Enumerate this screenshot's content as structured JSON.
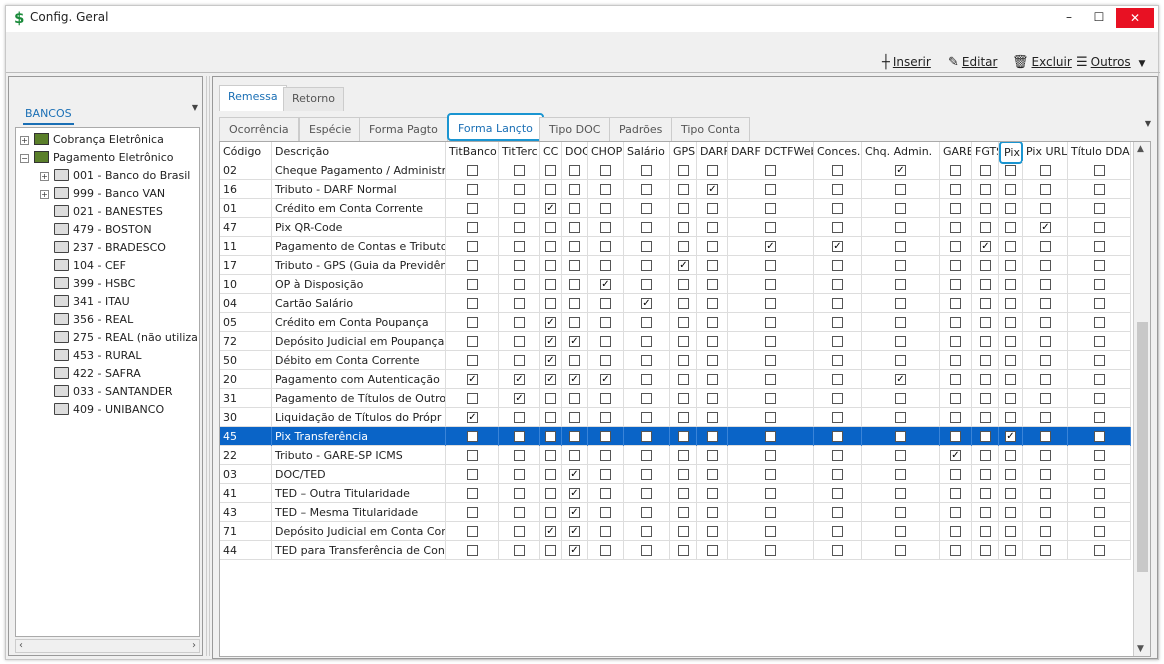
{
  "window": {
    "title": "Config. Geral",
    "minimize": "–",
    "maximize": "☐",
    "close": "✕"
  },
  "toolbar": {
    "inserir": "Inserir",
    "editar": "Editar",
    "excluir": "Excluir",
    "outros": "Outros"
  },
  "left": {
    "tab": "BANCOS",
    "tree": [
      {
        "label": "Cobrança Eletrônica",
        "level": 0,
        "exp": "+",
        "icon": "db"
      },
      {
        "label": "Pagamento Eletrônico",
        "level": 0,
        "exp": "-",
        "icon": "db"
      },
      {
        "label": "001 - Banco do Brasil",
        "level": 1,
        "exp": "+",
        "icon": "bank"
      },
      {
        "label": "999 - Banco VAN",
        "level": 1,
        "exp": "+",
        "icon": "bank"
      },
      {
        "label": "021 - BANESTES",
        "level": 1,
        "exp": "",
        "icon": "bank"
      },
      {
        "label": "479 - BOSTON",
        "level": 1,
        "exp": "",
        "icon": "bank"
      },
      {
        "label": "237 - BRADESCO",
        "level": 1,
        "exp": "",
        "icon": "bank"
      },
      {
        "label": "104 - CEF",
        "level": 1,
        "exp": "",
        "icon": "bank"
      },
      {
        "label": "399 - HSBC",
        "level": 1,
        "exp": "",
        "icon": "bank"
      },
      {
        "label": "341 - ITAU",
        "level": 1,
        "exp": "",
        "icon": "bank"
      },
      {
        "label": "356 - REAL",
        "level": 1,
        "exp": "",
        "icon": "bank"
      },
      {
        "label": "275 - REAL (não utiliza",
        "level": 1,
        "exp": "",
        "icon": "bank"
      },
      {
        "label": "453 - RURAL",
        "level": 1,
        "exp": "",
        "icon": "bank"
      },
      {
        "label": "422 - SAFRA",
        "level": 1,
        "exp": "",
        "icon": "bank"
      },
      {
        "label": "033 - SANTANDER",
        "level": 1,
        "exp": "",
        "icon": "bank"
      },
      {
        "label": "409 - UNIBANCO",
        "level": 1,
        "exp": "",
        "icon": "bank"
      }
    ]
  },
  "tabs_top": [
    "Remessa",
    "Retorno"
  ],
  "tabs_sub": [
    "Ocorrência",
    "Espécie",
    "Forma Pagto",
    "Forma Lançto",
    "Tipo DOC",
    "Padrões",
    "Tipo Conta"
  ],
  "grid": {
    "columns": [
      "Código",
      "Descrição",
      "TitBanco",
      "TitTerc",
      "CC",
      "DOC",
      "CHOP",
      "Salário",
      "GPS",
      "DARF",
      "DARF DCTFWeb",
      "Conces.",
      "Chq. Admin.",
      "GARE",
      "FGTS",
      "Pix",
      "Pix URL",
      "Título DDA"
    ],
    "rows": [
      {
        "code": "02",
        "desc": "Cheque Pagamento / Administr",
        "checks": [
          0,
          0,
          0,
          0,
          0,
          0,
          0,
          0,
          0,
          0,
          1,
          0,
          0,
          0,
          0,
          0
        ],
        "selected": false
      },
      {
        "code": "16",
        "desc": "Tributo - DARF Normal",
        "checks": [
          0,
          0,
          0,
          0,
          0,
          0,
          0,
          1,
          0,
          0,
          0,
          0,
          0,
          0,
          0,
          0
        ],
        "selected": false
      },
      {
        "code": "01",
        "desc": "Crédito em Conta Corrente",
        "checks": [
          0,
          0,
          1,
          0,
          0,
          0,
          0,
          0,
          0,
          0,
          0,
          0,
          0,
          0,
          0,
          0
        ],
        "selected": false
      },
      {
        "code": "47",
        "desc": "Pix QR-Code",
        "checks": [
          0,
          0,
          0,
          0,
          0,
          0,
          0,
          0,
          0,
          0,
          0,
          0,
          0,
          0,
          1,
          0
        ],
        "selected": false
      },
      {
        "code": "11",
        "desc": "Pagamento de Contas e Tributo",
        "checks": [
          0,
          0,
          0,
          0,
          0,
          0,
          0,
          0,
          1,
          1,
          0,
          0,
          1,
          0,
          0,
          0
        ],
        "selected": false
      },
      {
        "code": "17",
        "desc": "Tributo - GPS (Guia da Previdên",
        "checks": [
          0,
          0,
          0,
          0,
          0,
          0,
          1,
          0,
          0,
          0,
          0,
          0,
          0,
          0,
          0,
          0
        ],
        "selected": false
      },
      {
        "code": "10",
        "desc": "OP à Disposição",
        "checks": [
          0,
          0,
          0,
          0,
          1,
          0,
          0,
          0,
          0,
          0,
          0,
          0,
          0,
          0,
          0,
          0
        ],
        "selected": false
      },
      {
        "code": "04",
        "desc": "Cartão Salário",
        "checks": [
          0,
          0,
          0,
          0,
          0,
          1,
          0,
          0,
          0,
          0,
          0,
          0,
          0,
          0,
          0,
          0
        ],
        "selected": false
      },
      {
        "code": "05",
        "desc": "Crédito em Conta Poupança",
        "checks": [
          0,
          0,
          1,
          0,
          0,
          0,
          0,
          0,
          0,
          0,
          0,
          0,
          0,
          0,
          0,
          0
        ],
        "selected": false
      },
      {
        "code": "72",
        "desc": "Depósito Judicial em Poupança",
        "checks": [
          0,
          0,
          1,
          1,
          0,
          0,
          0,
          0,
          0,
          0,
          0,
          0,
          0,
          0,
          0,
          0
        ],
        "selected": false
      },
      {
        "code": "50",
        "desc": "Débito em Conta Corrente",
        "checks": [
          0,
          0,
          1,
          0,
          0,
          0,
          0,
          0,
          0,
          0,
          0,
          0,
          0,
          0,
          0,
          0
        ],
        "selected": false
      },
      {
        "code": "20",
        "desc": "Pagamento com Autenticação",
        "checks": [
          1,
          1,
          1,
          1,
          1,
          0,
          0,
          0,
          0,
          0,
          1,
          0,
          0,
          0,
          0,
          0
        ],
        "selected": false
      },
      {
        "code": "31",
        "desc": "Pagamento de Títulos de Outro",
        "checks": [
          0,
          1,
          0,
          0,
          0,
          0,
          0,
          0,
          0,
          0,
          0,
          0,
          0,
          0,
          0,
          0
        ],
        "selected": false
      },
      {
        "code": "30",
        "desc": "Liquidação de Títulos do Própr",
        "checks": [
          1,
          0,
          0,
          0,
          0,
          0,
          0,
          0,
          0,
          0,
          0,
          0,
          0,
          0,
          0,
          0
        ],
        "selected": false
      },
      {
        "code": "45",
        "desc": "Pix Transferência",
        "checks": [
          0,
          0,
          0,
          0,
          0,
          0,
          0,
          0,
          0,
          0,
          0,
          0,
          0,
          1,
          0,
          0
        ],
        "selected": true
      },
      {
        "code": "22",
        "desc": "Tributo - GARE-SP ICMS",
        "checks": [
          0,
          0,
          0,
          0,
          0,
          0,
          0,
          0,
          0,
          0,
          0,
          1,
          0,
          0,
          0,
          0
        ],
        "selected": false
      },
      {
        "code": "03",
        "desc": "DOC/TED",
        "checks": [
          0,
          0,
          0,
          1,
          0,
          0,
          0,
          0,
          0,
          0,
          0,
          0,
          0,
          0,
          0,
          0
        ],
        "selected": false
      },
      {
        "code": "41",
        "desc": "TED – Outra Titularidade",
        "checks": [
          0,
          0,
          0,
          1,
          0,
          0,
          0,
          0,
          0,
          0,
          0,
          0,
          0,
          0,
          0,
          0
        ],
        "selected": false
      },
      {
        "code": "43",
        "desc": "TED – Mesma Titularidade",
        "checks": [
          0,
          0,
          0,
          1,
          0,
          0,
          0,
          0,
          0,
          0,
          0,
          0,
          0,
          0,
          0,
          0
        ],
        "selected": false
      },
      {
        "code": "71",
        "desc": "Depósito Judicial em Conta Cor",
        "checks": [
          0,
          0,
          1,
          1,
          0,
          0,
          0,
          0,
          0,
          0,
          0,
          0,
          0,
          0,
          0,
          0
        ],
        "selected": false
      },
      {
        "code": "44",
        "desc": "TED para Transferência de Con",
        "checks": [
          0,
          0,
          0,
          1,
          0,
          0,
          0,
          0,
          0,
          0,
          0,
          0,
          0,
          0,
          0,
          0
        ],
        "selected": false
      }
    ]
  }
}
